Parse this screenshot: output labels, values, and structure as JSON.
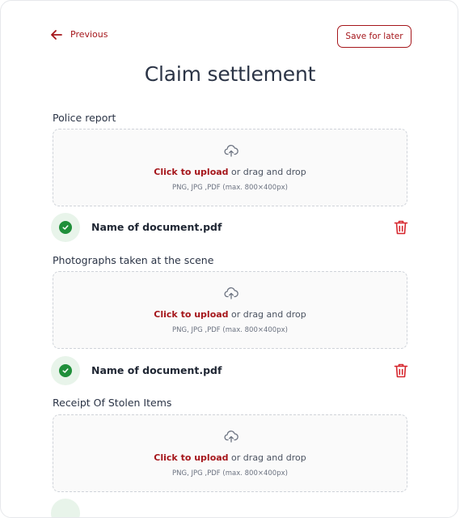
{
  "header": {
    "previous_label": "Previous",
    "save_label": "Save for later",
    "title": "Claim settlement"
  },
  "sections": [
    {
      "label": "Police report",
      "upload": {
        "link_text": "Click to upload",
        "rest_text": " or drag and drop",
        "hint": "PNG, JPG ,PDF (max. 800×400px)"
      },
      "file": {
        "name": "Name of document.pdf"
      }
    },
    {
      "label": "Photographs taken at the scene",
      "upload": {
        "link_text": "Click to upload",
        "rest_text": " or drag and drop",
        "hint": "PNG, JPG ,PDF (max. 800×400px)"
      },
      "file": {
        "name": "Name of document.pdf"
      }
    },
    {
      "label": "Receipt Of Stolen Items",
      "upload": {
        "link_text": "Click to upload",
        "rest_text": " or drag and drop",
        "hint": "PNG, JPG ,PDF (max. 800×400px)"
      }
    }
  ],
  "icons": {
    "back": "arrow-left-icon",
    "upload": "cloud-upload-icon",
    "success": "check-circle-icon",
    "delete": "trash-icon"
  },
  "colors": {
    "accent": "#a5161b",
    "success": "#1f8f3a",
    "success_bg": "#e8f4ea",
    "heading": "#2b3446",
    "upload_bg": "#fafafa",
    "upload_border": "#cfd3d9"
  }
}
